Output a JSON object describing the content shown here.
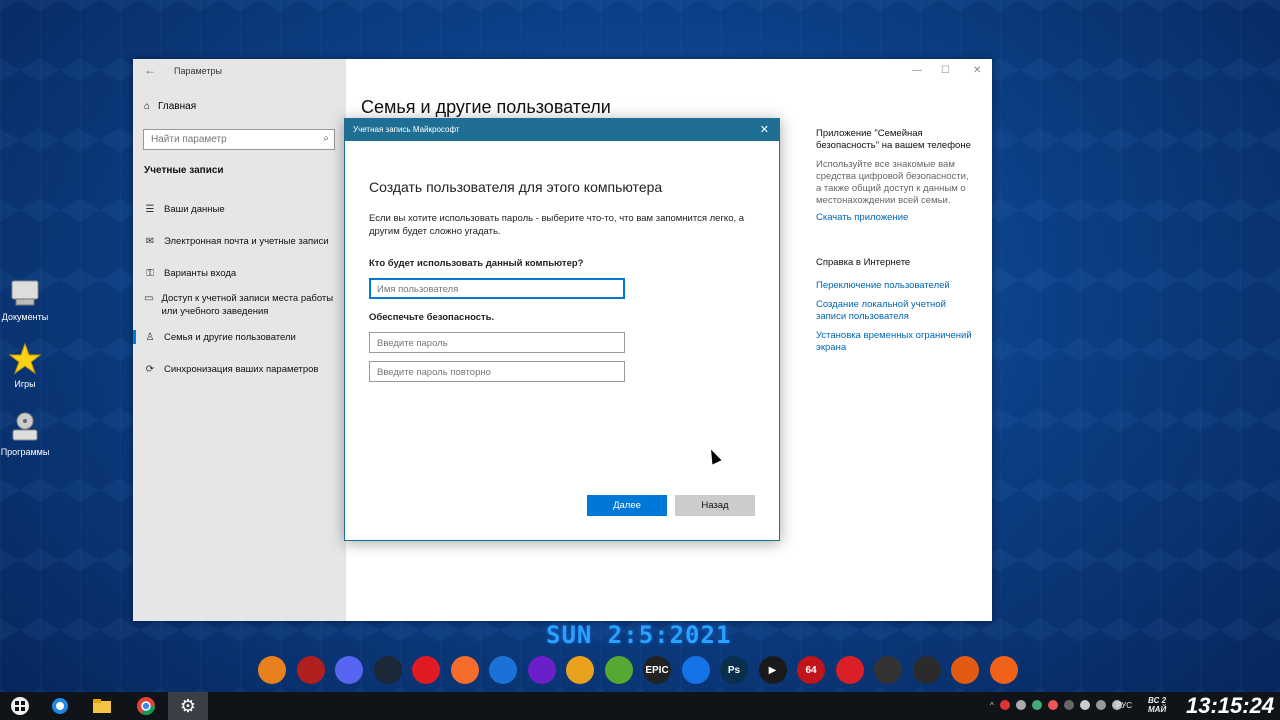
{
  "desktop": {
    "icons": [
      {
        "label": "Документы"
      },
      {
        "label": "Игры"
      },
      {
        "label": "Программы"
      }
    ],
    "date_text": "SUN 2:5:2021"
  },
  "window": {
    "title": "Параметры",
    "minimize": "—",
    "maximize": "☐",
    "close": "✕",
    "sidebar": {
      "home": "Главная",
      "search_placeholder": "Найти параметр",
      "section": "Учетные записи",
      "items": [
        {
          "label": "Ваши данные"
        },
        {
          "label": "Электронная почта и учетные записи"
        },
        {
          "label": "Варианты входа"
        },
        {
          "label": "Доступ к учетной записи места работы или учебного заведения"
        },
        {
          "label": "Семья и другие пользователи"
        },
        {
          "label": "Синхронизация ваших параметров"
        }
      ]
    },
    "content_title": "Семья и другие пользователи",
    "right": {
      "app_heading": "Приложение \"Семейная безопасность\" на вашем телефоне",
      "app_desc": "Используйте все знакомые вам средства цифровой безопасности, а также общий доступ к данным о местонахождении всей семьи.",
      "app_link": "Скачать приложение",
      "help_heading": "Справка в Интернете",
      "links": [
        "Переключение пользователей",
        "Создание локальной учетной записи пользователя",
        "Установка временных ограничений экрана"
      ]
    }
  },
  "dialog": {
    "header": "Учетная запись Майкрософт",
    "close": "✕",
    "title": "Создать пользователя для этого компьютера",
    "description": "Если вы хотите использовать пароль - выберите что-то, что вам запомнится легко, а другим будет сложно угадать.",
    "question": "Кто будет использовать данный компьютер?",
    "username_placeholder": "Имя пользователя",
    "security_heading": "Обеспечьте безопасность.",
    "password_placeholder": "Введите пароль",
    "password_repeat_placeholder": "Введите пароль повторно",
    "next_button": "Далее",
    "back_button": "Назад"
  },
  "dock": [
    {
      "name": "counter-strike-icon",
      "label": "",
      "color": "#e8801e"
    },
    {
      "name": "dota-icon",
      "label": "",
      "color": "#b21f1f"
    },
    {
      "name": "discord-icon",
      "label": "",
      "color": "#5865f2"
    },
    {
      "name": "steam-icon",
      "label": "",
      "color": "#1b2838"
    },
    {
      "name": "opera-icon",
      "label": "",
      "color": "#e01b24"
    },
    {
      "name": "origin-icon",
      "label": "",
      "color": "#f56c2d"
    },
    {
      "name": "uplay-icon",
      "label": "",
      "color": "#1a72d6"
    },
    {
      "name": "ring-app-icon",
      "label": "",
      "color": "#6b1fc8"
    },
    {
      "name": "chrome-canary-icon",
      "label": "",
      "color": "#e9a21d"
    },
    {
      "name": "utorrent-icon",
      "label": "",
      "color": "#56a832"
    },
    {
      "name": "epic-games-icon",
      "label": "EPIC",
      "color": "#222222"
    },
    {
      "name": "app-store-icon",
      "label": "",
      "color": "#1473e6"
    },
    {
      "name": "photoshop-icon",
      "label": "Ps",
      "color": "#0a2f4a"
    },
    {
      "name": "media-player-icon",
      "label": "▶",
      "color": "#1a1a1a"
    },
    {
      "name": "aida64-icon",
      "label": "64",
      "color": "#c0141a"
    },
    {
      "name": "creative-cloud-icon",
      "label": "",
      "color": "#da1f26"
    },
    {
      "name": "wargaming-icon",
      "label": "",
      "color": "#333333"
    },
    {
      "name": "obs-icon",
      "label": "",
      "color": "#2b2b2b"
    },
    {
      "name": "mask-app-icon",
      "label": "",
      "color": "#e35a12"
    },
    {
      "name": "telegram-like-icon",
      "label": "",
      "color": "#f0621a"
    }
  ],
  "taskbar": {
    "lang": "РУС",
    "day": "ВС",
    "day_num": "2",
    "month": "МАЙ",
    "time": "13:15:24"
  }
}
